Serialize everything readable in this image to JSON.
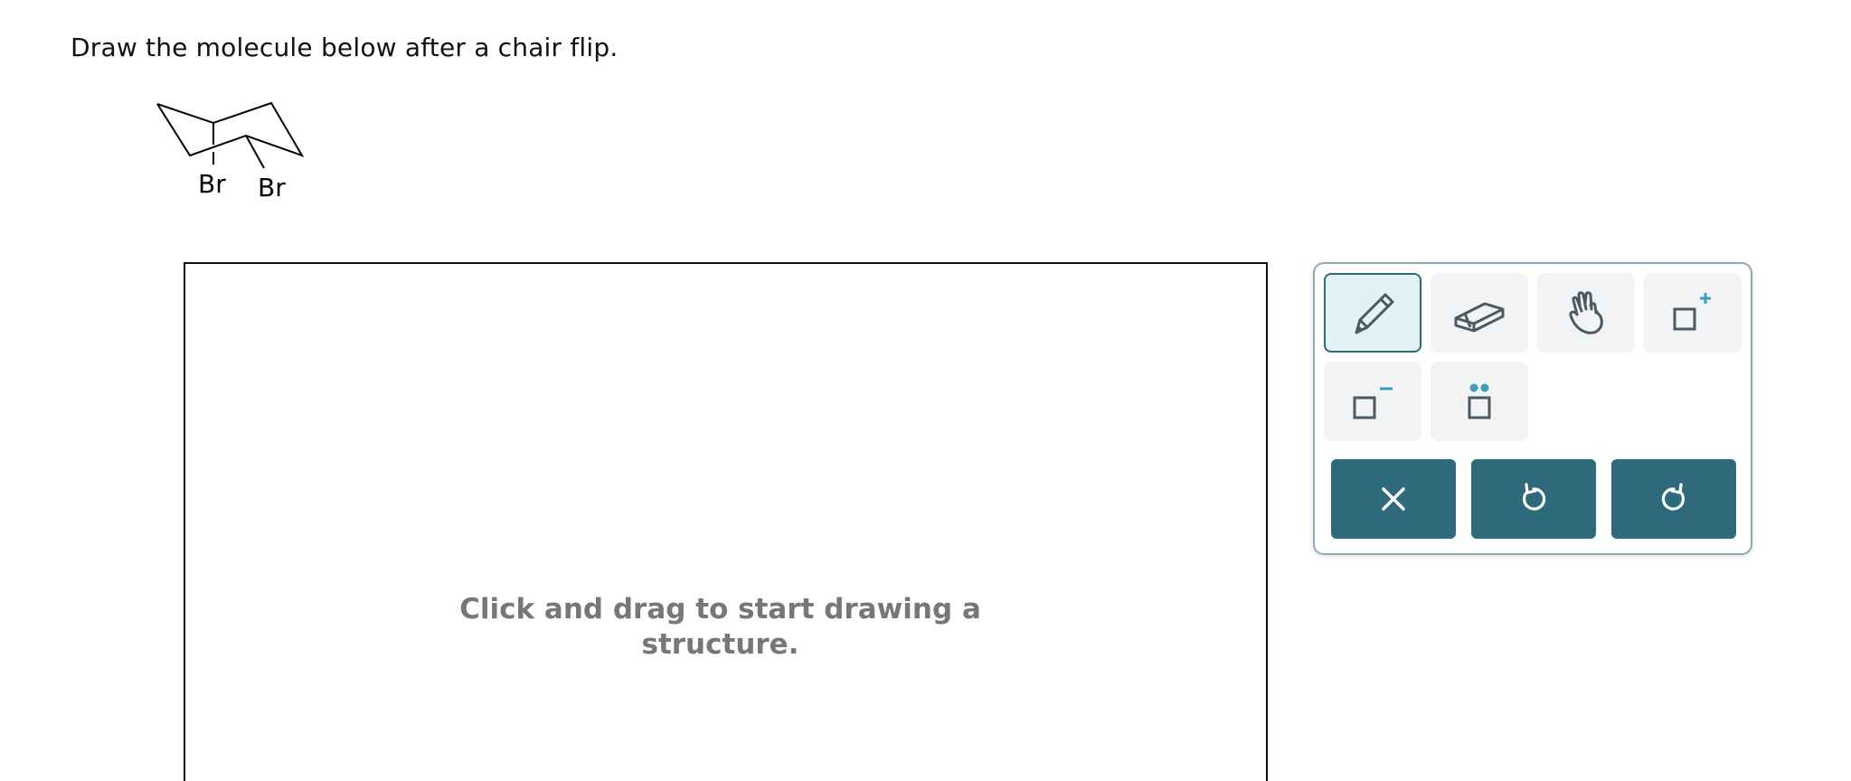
{
  "prompt": {
    "text": "Draw the molecule below after a chair flip."
  },
  "molecule": {
    "substituents": [
      "Br",
      "Br"
    ]
  },
  "canvas": {
    "hint": "Click and drag to start drawing a structure."
  },
  "toolbar": {
    "tools": [
      {
        "name": "pencil",
        "icon": "pencil-icon",
        "selected": true
      },
      {
        "name": "eraser",
        "icon": "eraser-icon",
        "selected": false
      },
      {
        "name": "hand",
        "icon": "hand-icon",
        "selected": false
      },
      {
        "name": "positive-charge",
        "icon": "positive-charge-icon",
        "selected": false
      },
      {
        "name": "negative-charge",
        "icon": "negative-charge-icon",
        "selected": false
      },
      {
        "name": "lone-pair",
        "icon": "lone-pair-icon",
        "selected": false
      }
    ],
    "actions": [
      {
        "name": "clear",
        "icon": "close-icon"
      },
      {
        "name": "undo",
        "icon": "undo-icon"
      },
      {
        "name": "redo",
        "icon": "redo-icon"
      }
    ]
  },
  "colors": {
    "accent": "#2e6a7c",
    "accent_light": "#3aa0b8",
    "icon": "#4a5a63",
    "tool_bg": "#f1f3f4",
    "selected_bg": "#e3f2f7",
    "hint_text": "#777777"
  }
}
